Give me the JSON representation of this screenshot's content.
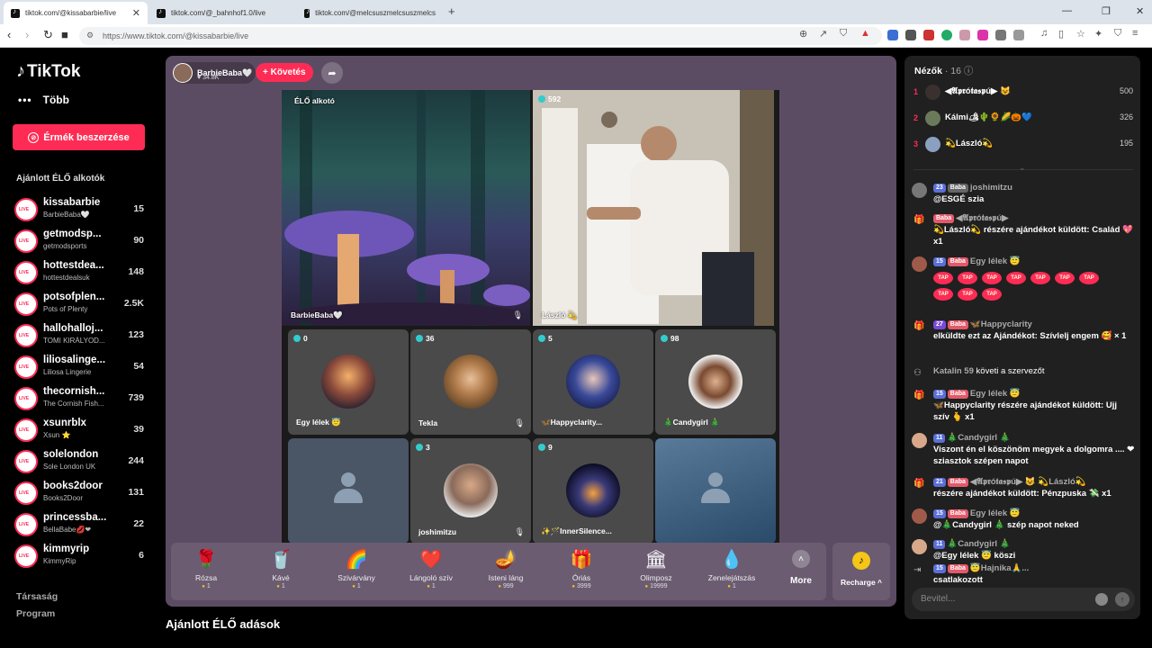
{
  "browser": {
    "tabs": [
      {
        "label": "tiktok.com/@kissabarbie/live"
      },
      {
        "label": "tiktok.com/@_bahnhof1.0/live"
      },
      {
        "label": "tiktok.com/@melcsuszmelcsuszmelcs"
      }
    ],
    "url": "https://www.tiktok.com/@kissabarbie/live"
  },
  "sidebar": {
    "logo": "TikTok",
    "more": "Több",
    "coins_button": "Érmék beszerzése",
    "section_title": "Ajánlott ÉLŐ alkotók",
    "creators": [
      {
        "name": "kissabarbie",
        "sub": "BarbieBaba🤍",
        "count": "15"
      },
      {
        "name": "getmodsp...",
        "sub": "getmodsports",
        "count": "90"
      },
      {
        "name": "hottestdea...",
        "sub": "hottestdealsuk",
        "count": "148"
      },
      {
        "name": "potsofplen...",
        "sub": "Pots of Plenty",
        "count": "2.5K"
      },
      {
        "name": "hallohalloj...",
        "sub": "TOMI KIRÁLYOD...",
        "count": "123"
      },
      {
        "name": "liliosalinge...",
        "sub": "Liliosa Lingerie",
        "count": "54"
      },
      {
        "name": "thecornish...",
        "sub": "The Cornish Fish...",
        "count": "739"
      },
      {
        "name": "xsunrblx",
        "sub": "Xsun ⭐",
        "count": "39"
      },
      {
        "name": "solelondon",
        "sub": "Sole London UK",
        "count": "244"
      },
      {
        "name": "books2door",
        "sub": "Books2Door",
        "count": "131"
      },
      {
        "name": "princessba...",
        "sub": "BellaBabe💋❤",
        "count": "22"
      },
      {
        "name": "kimmyrip",
        "sub": "KimmyRip",
        "count": "6"
      }
    ],
    "footer_links": [
      "Társaság",
      "Program"
    ]
  },
  "live": {
    "host_name": "BarbieBaba🤍",
    "host_likes": "34.8K",
    "follow_label": "+ Követés",
    "main_tiles": [
      {
        "top_label": "ÉLŐ alkotó",
        "bottom_label": "BarbieBaba🤍"
      },
      {
        "viewers": "592",
        "bottom_label": "László 💫"
      }
    ],
    "tiles": [
      {
        "viewers": "0",
        "name": "Egy lélek 😇"
      },
      {
        "viewers": "36",
        "name": "Tekla"
      },
      {
        "viewers": "5",
        "name": "🦋Happyclarity..."
      },
      {
        "viewers": "98",
        "name": "🎄Candygirl 🎄"
      },
      {
        "viewers": "",
        "name": ""
      },
      {
        "viewers": "3",
        "name": "joshimitzu"
      },
      {
        "viewers": "9",
        "name": "✨🪄InnerSilence..."
      },
      {
        "viewers": "",
        "name": ""
      }
    ],
    "gifts": [
      {
        "icon": "🌹",
        "name": "Rózsa",
        "price": "1"
      },
      {
        "icon": "🥤",
        "name": "Kávé",
        "price": "1"
      },
      {
        "icon": "🌈",
        "name": "Szivárvány",
        "price": "1"
      },
      {
        "icon": "❤️",
        "name": "Lángoló szív",
        "price": "1"
      },
      {
        "icon": "🪔",
        "name": "Isteni láng",
        "price": "999"
      },
      {
        "icon": "🎁",
        "name": "Óriás",
        "price": "3999"
      },
      {
        "icon": "🏛",
        "name": "Olimposz",
        "price": "19999"
      },
      {
        "icon": "💧",
        "name": "Zenelejátszás",
        "price": "1"
      }
    ],
    "more_label": "More",
    "recharge_label": "Recharge ^",
    "recommended_title": "Ajánlott ÉLŐ adások"
  },
  "chat": {
    "viewers_title": "Nézők",
    "viewers_count": "· 16",
    "top": [
      {
        "rank": "1",
        "name": "◀𝕬𝖕𝖗ó𝖙𝖆𝖘𝖕ú▶ 😺",
        "score": "500"
      },
      {
        "rank": "2",
        "name": "Kálmi🏕🌵🌻🌽🎃💙",
        "score": "326"
      },
      {
        "rank": "3",
        "name": "💫László💫",
        "score": "195"
      }
    ],
    "messages": [
      {
        "lvl": "23",
        "fan": "Baba",
        "user": "joshimitzu",
        "text": "@ESGÉ szia"
      },
      {
        "lvl": "",
        "fan": "Baba",
        "user": "◀𝕬𝖕𝖗ó𝖙𝖆𝖘𝖕ú▶",
        "text": "💫László💫 részére ajándékot küldött: Család 💖 x1"
      },
      {
        "lvl": "15",
        "fan": "Baba",
        "user": "Egy lélek 😇",
        "text": ""
      },
      {
        "lvl": "27",
        "fan": "Baba",
        "user": "🦋Happyclarity",
        "text": "elküldte ezt az Ajándékot: Szívlelj engem 🥰 × 1"
      },
      {
        "lvl": "",
        "fan": "",
        "user": "Katalin 59",
        "text": "követi a szervezőt"
      },
      {
        "lvl": "15",
        "fan": "Baba",
        "user": "Egy lélek 😇",
        "text": "🦋Happyclarity részére ajándékot küldött: Ujj szív 🫰 x1"
      },
      {
        "lvl": "11",
        "fan": "",
        "user": "🎄Candygirl 🎄",
        "text": "Viszont én el köszönöm megyek a dolgomra .... ❤ sziasztok szépen napot"
      },
      {
        "lvl": "21",
        "fan": "Baba",
        "user": "◀𝕬𝖕𝖗ó𝖙𝖆𝖘𝖕ú▶ 😺 💫László💫",
        "text": "részére ajándékot küldött: Pénzpuska 💸 x1"
      },
      {
        "lvl": "15",
        "fan": "Baba",
        "user": "Egy lélek 😇",
        "text": "@🎄Candygirl 🎄 szép napot neked"
      },
      {
        "lvl": "11",
        "fan": "",
        "user": "🎄Candygirl 🎄",
        "text": "@Egy lélek 😇 köszi"
      },
      {
        "lvl": "15",
        "fan": "Baba",
        "user": "😇Hajnika🙏...",
        "text": "csatlakozott"
      }
    ],
    "tap_label": "TAP",
    "input_placeholder": "Bevitel..."
  }
}
